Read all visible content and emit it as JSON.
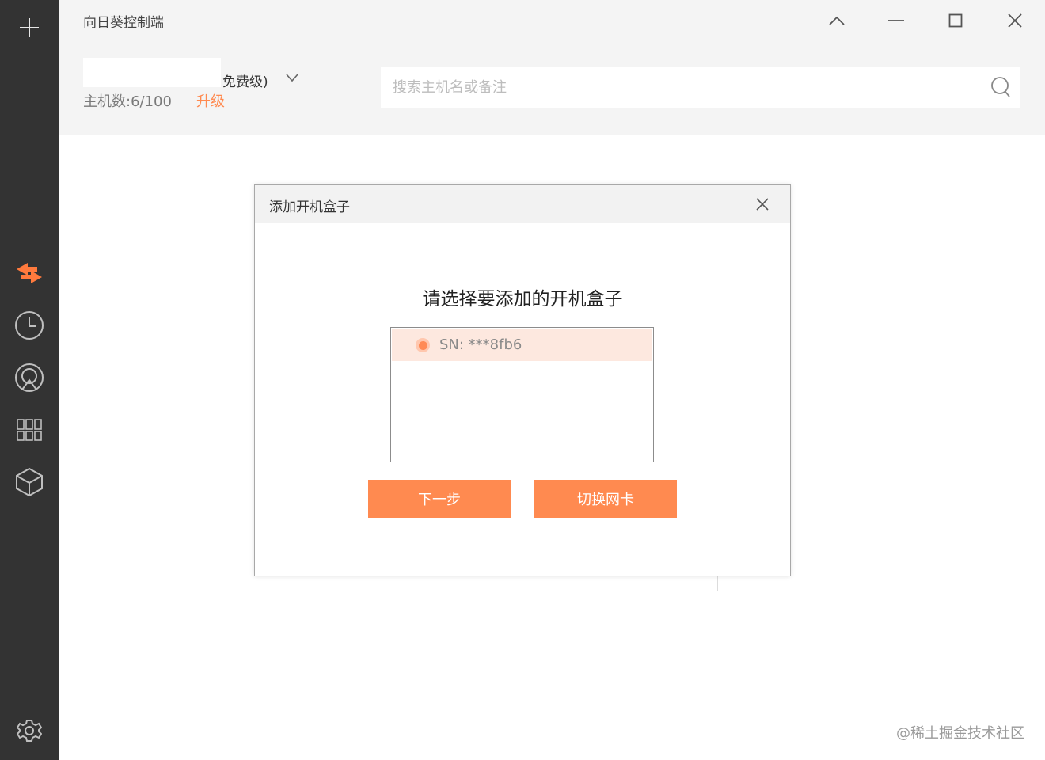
{
  "app": {
    "title": "向日葵控制端"
  },
  "sidebar": {
    "items": [
      {
        "icon": "plus-icon"
      },
      {
        "icon": "remote-control-icon",
        "active": true
      },
      {
        "icon": "history-clock-icon"
      },
      {
        "icon": "discovery-icon"
      },
      {
        "icon": "apps-grid-icon"
      },
      {
        "icon": "device-box-icon"
      },
      {
        "icon": "settings-gear-icon"
      }
    ]
  },
  "window_controls": {
    "collapse": "chevron-up-icon",
    "minimize": "minimize-icon",
    "maximize": "maximize-icon",
    "close": "close-icon"
  },
  "account": {
    "tier_label": "免费级)",
    "host_count_label": "主机数:6/100",
    "upgrade_label": "升级"
  },
  "search": {
    "placeholder": "搜索主机名或备注",
    "value": ""
  },
  "dialog": {
    "title": "添加开机盒子",
    "heading": "请选择要添加的开机盒子",
    "items": [
      {
        "label": "SN: ***8fb6",
        "selected": true
      }
    ],
    "next_button": "下一步",
    "switch_nic_button": "切换网卡"
  },
  "watermark": "@稀土掘金技术社区",
  "colors": {
    "accent": "#ff8a50",
    "sidebar_bg": "#333333",
    "header_bg": "#f4f4f4",
    "selected_row_bg": "#fde8df"
  }
}
